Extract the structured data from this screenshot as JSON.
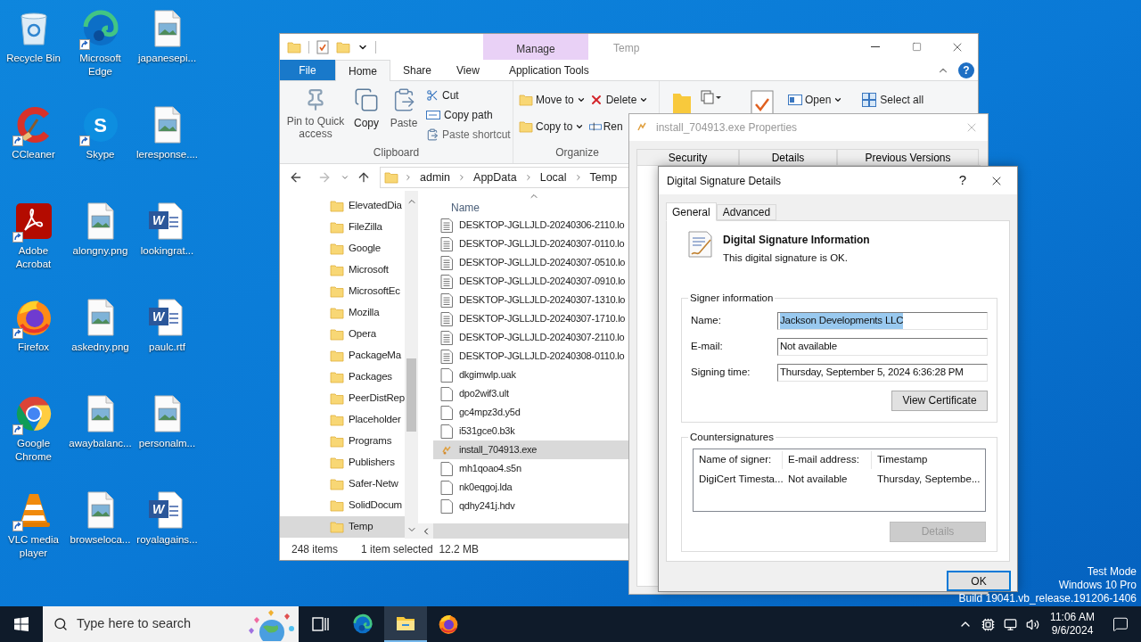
{
  "desktop_icons": [
    {
      "label": "Recycle Bin",
      "kind": "recycle",
      "shortcut": false
    },
    {
      "label": "Microsoft Edge",
      "kind": "edge",
      "shortcut": true
    },
    {
      "label": "japanesepi...",
      "kind": "image",
      "shortcut": false
    },
    {
      "label": "CCleaner",
      "kind": "ccleaner",
      "shortcut": true
    },
    {
      "label": "Skype",
      "kind": "skype",
      "shortcut": true,
      "badge": "S"
    },
    {
      "label": "leresponse....",
      "kind": "image",
      "shortcut": false
    },
    {
      "label": "Adobe Acrobat",
      "kind": "acrobat",
      "shortcut": true
    },
    {
      "label": "alongny.png",
      "kind": "image",
      "shortcut": false
    },
    {
      "label": "lookingrat...",
      "kind": "word",
      "shortcut": false,
      "badge": "W"
    },
    {
      "label": "Firefox",
      "kind": "firefox",
      "shortcut": true
    },
    {
      "label": "askedny.png",
      "kind": "image",
      "shortcut": false
    },
    {
      "label": "paulc.rtf",
      "kind": "word",
      "shortcut": false,
      "badge": "W"
    },
    {
      "label": "Google Chrome",
      "kind": "chrome",
      "shortcut": true
    },
    {
      "label": "awaybalanc...",
      "kind": "image",
      "shortcut": false
    },
    {
      "label": "personalm...",
      "kind": "image",
      "shortcut": false
    },
    {
      "label": "VLC media player",
      "kind": "vlc",
      "shortcut": true
    },
    {
      "label": "browseloca...",
      "kind": "image",
      "shortcut": false
    },
    {
      "label": "royalagains...",
      "kind": "word",
      "shortcut": false,
      "badge": "W"
    }
  ],
  "explorer": {
    "title": "Temp",
    "context_tab": "Manage",
    "help": "?",
    "tabs": [
      {
        "label": "File",
        "kind": "file",
        "selected": false
      },
      {
        "label": "Home",
        "kind": "normal",
        "selected": true
      },
      {
        "label": "Share",
        "kind": "normal",
        "selected": false
      },
      {
        "label": "View",
        "kind": "normal",
        "selected": false
      },
      {
        "label": "Application Tools",
        "kind": "context",
        "selected": false
      }
    ],
    "clipboard": {
      "label": "Clipboard",
      "pin": "Pin to Quick access",
      "copy": "Copy",
      "paste": "Paste",
      "cut": "Cut",
      "copy_path": "Copy path",
      "paste_shortcut": "Paste shortcut"
    },
    "organize": {
      "label": "Organize",
      "move_to": "Move to",
      "copy_to": "Copy to",
      "delete": "Delete",
      "rename": "Ren"
    },
    "open_group": {
      "open": "Open",
      "select_all": "Select all"
    },
    "path": [
      "admin",
      "AppData",
      "Local",
      "Temp"
    ],
    "nav_items": [
      {
        "label": "ElevatedDia",
        "selected": false
      },
      {
        "label": "FileZilla",
        "selected": false
      },
      {
        "label": "Google",
        "selected": false
      },
      {
        "label": "Microsoft",
        "selected": false
      },
      {
        "label": "MicrosoftEc",
        "selected": false
      },
      {
        "label": "Mozilla",
        "selected": false
      },
      {
        "label": "Opera",
        "selected": false
      },
      {
        "label": "PackageMa",
        "selected": false
      },
      {
        "label": "Packages",
        "selected": false
      },
      {
        "label": "PeerDistRep",
        "selected": false
      },
      {
        "label": "Placeholder",
        "selected": false
      },
      {
        "label": "Programs",
        "selected": false
      },
      {
        "label": "Publishers",
        "selected": false
      },
      {
        "label": "Safer-Netw",
        "selected": false
      },
      {
        "label": "SolidDocum",
        "selected": false
      },
      {
        "label": "Temp",
        "selected": true
      }
    ],
    "column_header": "Name",
    "files": [
      {
        "name": "DESKTOP-JGLLJLD-20240306-2110.lo",
        "kind": "log",
        "selected": false
      },
      {
        "name": "DESKTOP-JGLLJLD-20240307-0110.lo",
        "kind": "log",
        "selected": false
      },
      {
        "name": "DESKTOP-JGLLJLD-20240307-0510.lo",
        "kind": "log",
        "selected": false
      },
      {
        "name": "DESKTOP-JGLLJLD-20240307-0910.lo",
        "kind": "log",
        "selected": false
      },
      {
        "name": "DESKTOP-JGLLJLD-20240307-1310.lo",
        "kind": "log",
        "selected": false
      },
      {
        "name": "DESKTOP-JGLLJLD-20240307-1710.lo",
        "kind": "log",
        "selected": false
      },
      {
        "name": "DESKTOP-JGLLJLD-20240307-2110.lo",
        "kind": "log",
        "selected": false
      },
      {
        "name": "DESKTOP-JGLLJLD-20240308-0110.lo",
        "kind": "log",
        "selected": false
      },
      {
        "name": "dkgimwlp.uak",
        "kind": "blank",
        "selected": false
      },
      {
        "name": "dpo2wif3.ult",
        "kind": "blank",
        "selected": false
      },
      {
        "name": "gc4mpz3d.y5d",
        "kind": "blank",
        "selected": false
      },
      {
        "name": "i531gce0.b3k",
        "kind": "blank",
        "selected": false
      },
      {
        "name": "install_704913.exe",
        "kind": "exe",
        "selected": true
      },
      {
        "name": "mh1qoao4.s5n",
        "kind": "blank",
        "selected": false
      },
      {
        "name": "nk0eqgoj.lda",
        "kind": "blank",
        "selected": false
      },
      {
        "name": "qdhy241j.hdv",
        "kind": "blank",
        "selected": false
      }
    ],
    "status": {
      "count": "248 items",
      "selection": "1 item selected",
      "size": "12.2 MB"
    }
  },
  "properties": {
    "title": "install_704913.exe Properties",
    "tabs": [
      "Security",
      "Details",
      "Previous Versions"
    ]
  },
  "dialog": {
    "title": "Digital Signature Details",
    "help": "?",
    "tabs": [
      {
        "label": "General",
        "selected": true
      },
      {
        "label": "Advanced",
        "selected": false
      }
    ],
    "heading": "Digital Signature Information",
    "status": "This digital signature is OK.",
    "signer_group": "Signer information",
    "fields": [
      {
        "label": "Name:",
        "value": "Jackson Developments LLC",
        "selected": true
      },
      {
        "label": "E-mail:",
        "value": "Not available",
        "selected": false
      },
      {
        "label": "Signing time:",
        "value": "Thursday, September 5, 2024 6:36:28 PM",
        "selected": false
      }
    ],
    "view_certificate": "View Certificate",
    "countersignatures_group": "Countersignatures",
    "columns": [
      "Name of signer:",
      "E-mail address:",
      "Timestamp"
    ],
    "rows": [
      [
        "DigiCert Timesta...",
        "Not available",
        "Thursday, Septembe..."
      ]
    ],
    "details_button": {
      "label": "Details",
      "disabled": true
    },
    "ok_button": "OK"
  },
  "system_notice": [
    "Test Mode",
    "Windows 10 Pro",
    "Build 19041.vb_release.191206-1406"
  ],
  "taskbar": {
    "search_placeholder": "Type here to search",
    "apps": [
      {
        "kind": "taskview",
        "active": false
      },
      {
        "kind": "edge",
        "active": false
      },
      {
        "kind": "explorer",
        "active": true
      },
      {
        "kind": "firefox",
        "active": false
      }
    ],
    "time": "11:06 AM",
    "date": "9/6/2024"
  }
}
